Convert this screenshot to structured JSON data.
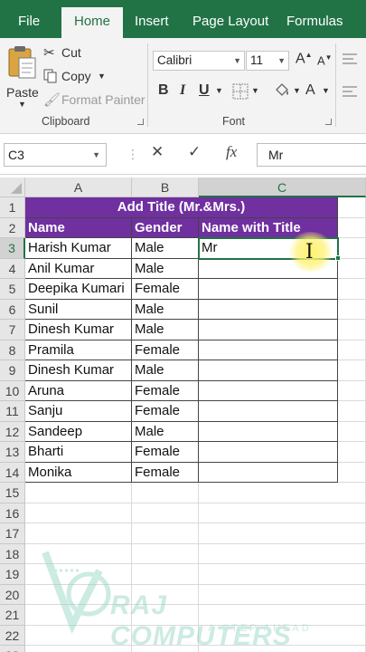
{
  "ribbon_tabs": [
    {
      "label": "File",
      "active": false
    },
    {
      "label": "Home",
      "active": true
    },
    {
      "label": "Insert",
      "active": false
    },
    {
      "label": "Page Layout",
      "active": false
    },
    {
      "label": "Formulas",
      "active": false
    }
  ],
  "clipboard": {
    "paste_label": "Paste",
    "cut_label": "Cut",
    "copy_label": "Copy",
    "format_painter_label": "Format Painter",
    "group_label": "Clipboard"
  },
  "font": {
    "font_name": "Calibri",
    "font_size": "11",
    "bold": "B",
    "italic": "I",
    "underline": "U",
    "font_color": "A",
    "group_label": "Font"
  },
  "formula_bar": {
    "name_box": "C3",
    "cancel": "✕",
    "enter": "✓",
    "fx": "fx",
    "content": "Mr"
  },
  "grid": {
    "columns": [
      "A",
      "B",
      "C"
    ],
    "rows": [
      "1",
      "2",
      "3",
      "4",
      "5",
      "6",
      "7",
      "8",
      "9",
      "10",
      "11",
      "12",
      "13",
      "14",
      "15",
      "16",
      "17",
      "18",
      "19",
      "20",
      "21",
      "22",
      "23"
    ],
    "selected_column": "C",
    "selected_row": "3",
    "title": "Add Title (Mr.&Mrs.)",
    "headers": [
      "Name",
      "Gender",
      "Name with Title"
    ],
    "data": [
      [
        "Harish Kumar",
        "Male",
        "Mr"
      ],
      [
        "Anil Kumar",
        "Male",
        ""
      ],
      [
        "Deepika Kumari",
        "Female",
        ""
      ],
      [
        "Sunil",
        "Male",
        ""
      ],
      [
        "Dinesh Kumar",
        "Male",
        ""
      ],
      [
        "Pramila",
        "Female",
        ""
      ],
      [
        "Dinesh Kumar",
        "Male",
        ""
      ],
      [
        "Aruna",
        "Female",
        ""
      ],
      [
        "Sanju",
        "Female",
        ""
      ],
      [
        "Sandeep",
        "Male",
        ""
      ],
      [
        "Bharti",
        "Female",
        ""
      ],
      [
        "Monika",
        "Female",
        ""
      ]
    ]
  },
  "watermark": {
    "name": "RAJ COMPUTERS",
    "tagline": "A STEP AHEAD"
  },
  "colors": {
    "excel_green": "#217346",
    "header_purple": "#7030a0"
  }
}
